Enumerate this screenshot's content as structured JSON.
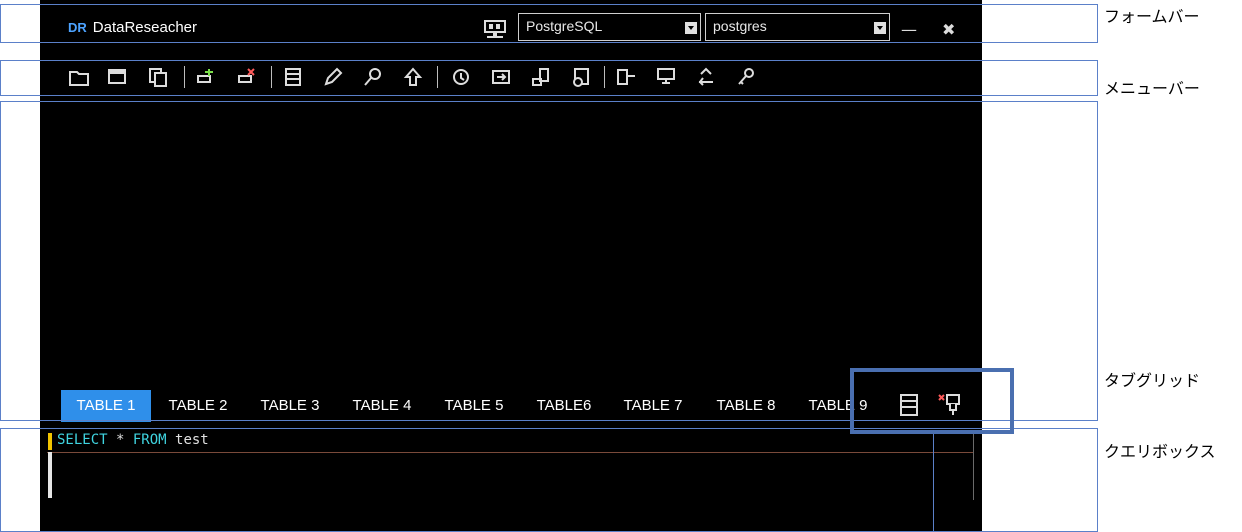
{
  "titlebar": {
    "brand_mark": "DR",
    "app_name": "DataReseacher",
    "db_type": "PostgreSQL",
    "db_name": "postgres"
  },
  "toolbar": {
    "icons": [
      "open-folder-icon",
      "window-icon",
      "copy-icon",
      "add-connection-icon",
      "remove-connection-icon",
      "grid-icon",
      "edit-icon",
      "search-icon",
      "up-arrow-icon",
      "refresh-icon",
      "export-icon",
      "database-icon",
      "script-icon",
      "filter-icon",
      "monitor-icon",
      "recycle-icon",
      "key-icon"
    ]
  },
  "tabs": [
    {
      "label": "TABLE 1",
      "active": true
    },
    {
      "label": "TABLE 2",
      "active": false
    },
    {
      "label": "TABLE 3",
      "active": false
    },
    {
      "label": "TABLE 4",
      "active": false
    },
    {
      "label": "TABLE 5",
      "active": false
    },
    {
      "label": "TABLE6",
      "active": false
    },
    {
      "label": "TABLE 7",
      "active": false
    },
    {
      "label": "TABLE 8",
      "active": false
    },
    {
      "label": "TABLE 9",
      "active": false
    }
  ],
  "query": {
    "kw_select": "SELECT",
    "star": " * ",
    "kw_from": "FROM",
    "rest": " test"
  },
  "annotations": {
    "form_bar": "フォームバー",
    "menu_bar": "メニューバー",
    "tab_grid": "タブグリッド",
    "query_box": "クエリボックス"
  },
  "colors": {
    "active_tab": "#2f8fea",
    "keyword": "#3fd4e0",
    "annotation_border": "#5b80c9"
  }
}
